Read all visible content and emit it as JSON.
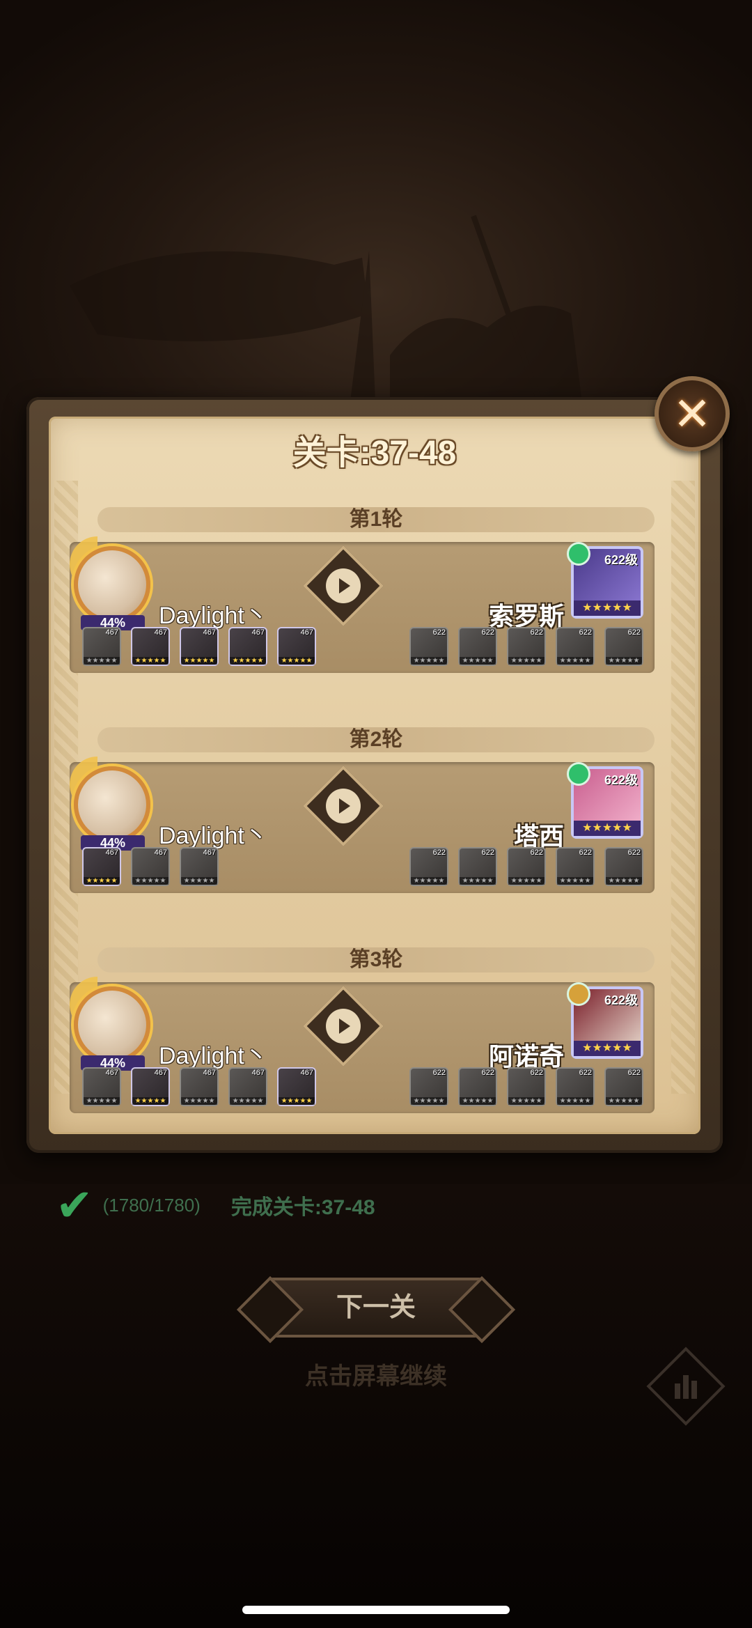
{
  "title": "关卡:37-48",
  "close_icon": "close-icon",
  "rounds": [
    {
      "label": "第1轮",
      "player": {
        "name": "Daylight丶",
        "percent": "44%",
        "team": [
          {
            "lvl": "467"
          },
          {
            "lvl": "467"
          },
          {
            "lvl": "467"
          },
          {
            "lvl": "467"
          },
          {
            "lvl": "467"
          }
        ]
      },
      "enemy": {
        "name": "索罗斯",
        "level": "622级",
        "stars": "★★★★★",
        "team": [
          {
            "lvl": "622"
          },
          {
            "lvl": "622"
          },
          {
            "lvl": "622"
          },
          {
            "lvl": "622"
          },
          {
            "lvl": "622"
          }
        ]
      }
    },
    {
      "label": "第2轮",
      "player": {
        "name": "Daylight丶",
        "percent": "44%",
        "team": [
          {
            "lvl": "467"
          },
          {
            "lvl": "467"
          },
          {
            "lvl": "467"
          }
        ]
      },
      "enemy": {
        "name": "塔西",
        "level": "622级",
        "stars": "★★★★★",
        "team": [
          {
            "lvl": "622"
          },
          {
            "lvl": "622"
          },
          {
            "lvl": "622"
          },
          {
            "lvl": "622"
          },
          {
            "lvl": "622"
          }
        ]
      }
    },
    {
      "label": "第3轮",
      "player": {
        "name": "Daylight丶",
        "percent": "44%",
        "team": [
          {
            "lvl": "467"
          },
          {
            "lvl": "467"
          },
          {
            "lvl": "467"
          },
          {
            "lvl": "467"
          },
          {
            "lvl": "467"
          }
        ]
      },
      "enemy": {
        "name": "阿诺奇",
        "level": "622级",
        "stars": "★★★★★",
        "team": [
          {
            "lvl": "622"
          },
          {
            "lvl": "622"
          },
          {
            "lvl": "622"
          },
          {
            "lvl": "622"
          },
          {
            "lvl": "622"
          }
        ]
      }
    }
  ],
  "footer": {
    "progress": "(1780/1780)",
    "complete": "完成关卡:37-48",
    "next": "下一关",
    "tap_continue": "点击屏幕继续"
  },
  "unit_stars": "★★★★★",
  "colors": {
    "accent": "#f3c24a",
    "parchment": "#e4cda3",
    "success": "#3aa55a"
  }
}
